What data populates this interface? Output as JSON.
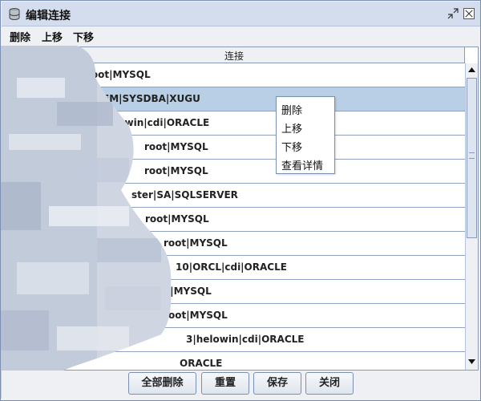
{
  "window": {
    "title": "编辑连接"
  },
  "menubar": {
    "items": [
      "删除",
      "上移",
      "下移"
    ]
  },
  "table": {
    "column_header": "连接",
    "rows": [
      "root|MYSQL",
      "EM|SYSDBA|XUGU",
      "elowin|cdi|ORACLE",
      "root|MYSQL",
      "root|MYSQL",
      "ster|SA|SQLSERVER",
      "root|MYSQL",
      "root|MYSQL",
      "10|ORCL|cdi|ORACLE",
      "oot|MYSQL",
      "6||root|MYSQL",
      "3|helowin|cdi|ORACLE",
      "ORACLE"
    ],
    "selected_row_index": 1
  },
  "context_menu": {
    "items": [
      "删除",
      "上移",
      "下移",
      "查看详情"
    ]
  },
  "buttons": {
    "delete_all": "全部删除",
    "reset": "重置",
    "save": "保存",
    "close": "关闭"
  },
  "colors": {
    "selection": "#b8cfe5",
    "titlebar": "#d3ddee",
    "border": "#7b8fb0"
  }
}
